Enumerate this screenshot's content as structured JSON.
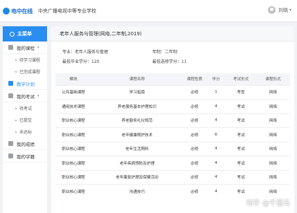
{
  "header": {
    "logo_text": "电中在线",
    "school_name": "中央广播电视中等专业学校",
    "user_name": "刘晓"
  },
  "sidebar": {
    "menu_title": "主菜单",
    "items": [
      {
        "label": "我的课程",
        "icon": "book-icon",
        "has_caret": true
      },
      {
        "label": "待学习课程",
        "sub": true
      },
      {
        "label": "已完成课程",
        "sub": true
      },
      {
        "label": "教学计划",
        "icon": "plan-icon",
        "active": true
      },
      {
        "label": "我的考试",
        "icon": "exam-icon",
        "has_caret": true
      },
      {
        "label": "待考试",
        "sub": true
      },
      {
        "label": "已提交",
        "sub": true
      },
      {
        "label": "未达标",
        "sub": true
      },
      {
        "label": "我的成绩",
        "icon": "score-icon"
      },
      {
        "label": "我的学籍",
        "icon": "status-icon"
      }
    ]
  },
  "plan": {
    "title": "老年人服务与管理(网络,二年制,2019)",
    "major_label": "专业：老年人服务与管理",
    "years_label": "年制：二年制",
    "min_credit_label": "最低毕业学分：120",
    "min_elective_label": "最低选修学分：11"
  },
  "table": {
    "headers": [
      "模块",
      "课程名称",
      "课程性质",
      "学分",
      "考试形式",
      "课程形式"
    ],
    "rows": [
      [
        "公共基础课程",
        "学习指南",
        "必修",
        "1",
        "考查",
        "网络"
      ],
      [
        "通用技术课程",
        "养老服务基本护理知识",
        "必修",
        "4",
        "考试",
        "网络"
      ],
      [
        "职业核心课程",
        "养老服务礼仪规范",
        "必修",
        "4",
        "考试",
        "网络"
      ],
      [
        "职业核心课程",
        "老年健康照护技术",
        "必修",
        "6",
        "考试",
        "网络"
      ],
      [
        "职业核心课程",
        "老年生活照料",
        "必修",
        "4",
        "考试",
        "网络"
      ],
      [
        "职业核心课程",
        "老年疾病预防及护理",
        "必修",
        "4",
        "考试",
        "网络"
      ],
      [
        "职业核心课程",
        "老年康复护理及保健活动",
        "必修",
        "4",
        "考试",
        "网络"
      ],
      [
        "职业核心课程",
        "沟通技巧",
        "必修",
        "4",
        "考试",
        "网络"
      ]
    ]
  },
  "watermark": "知乎 @千里马"
}
